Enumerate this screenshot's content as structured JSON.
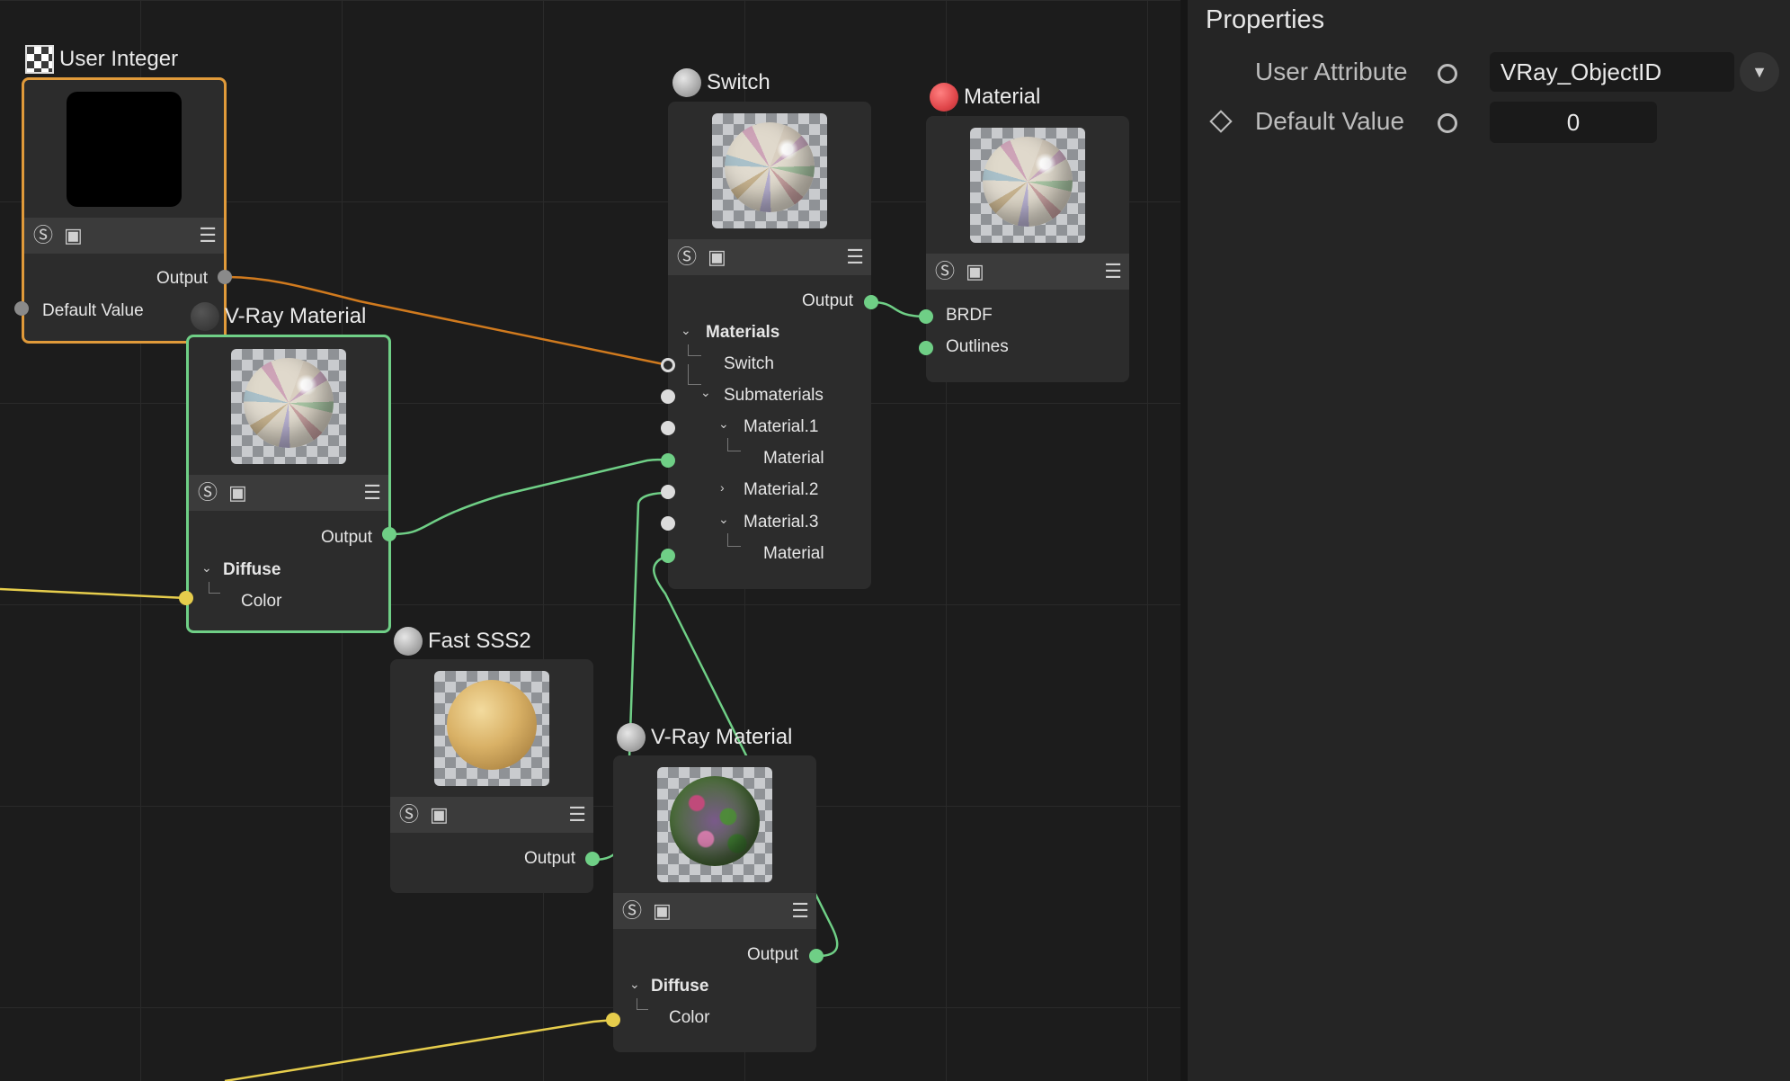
{
  "nodes": {
    "user_integer": {
      "title": "User Integer",
      "ports": {
        "output": "Output",
        "default_value": "Default Value"
      }
    },
    "vray_material_1": {
      "title": "V-Ray Material",
      "ports": {
        "output": "Output",
        "diffuse": "Diffuse",
        "color": "Color"
      }
    },
    "switch": {
      "title": "Switch",
      "ports": {
        "output": "Output",
        "materials": "Materials",
        "switch": "Switch",
        "submaterials": "Submaterials",
        "material_1": "Material.1",
        "material_1_material": "Material",
        "material_2": "Material.2",
        "material_3": "Material.3",
        "material_3_material": "Material"
      }
    },
    "material": {
      "title": "Material",
      "ports": {
        "brdf": "BRDF",
        "outlines": "Outlines"
      }
    },
    "fast_sss2": {
      "title": "Fast SSS2",
      "ports": {
        "output": "Output"
      }
    },
    "vray_material_2": {
      "title": "V-Ray Material",
      "ports": {
        "output": "Output",
        "diffuse": "Diffuse",
        "color": "Color"
      }
    }
  },
  "properties": {
    "title": "Properties",
    "user_attribute_label": "User Attribute",
    "user_attribute_value": "VRay_ObjectID",
    "default_value_label": "Default Value",
    "default_value_value": "0"
  },
  "colors": {
    "canvas": "#1c1c1c",
    "panel": "#252525",
    "wire_orange": "#d07a1e",
    "wire_green": "#6fcf86",
    "wire_yellow": "#e6cd4c"
  },
  "icons": [
    "solo-icon",
    "image-icon",
    "menu-icon",
    "dropdown-arrow-icon",
    "keyframe-diamond-icon",
    "animate-ring-icon"
  ]
}
